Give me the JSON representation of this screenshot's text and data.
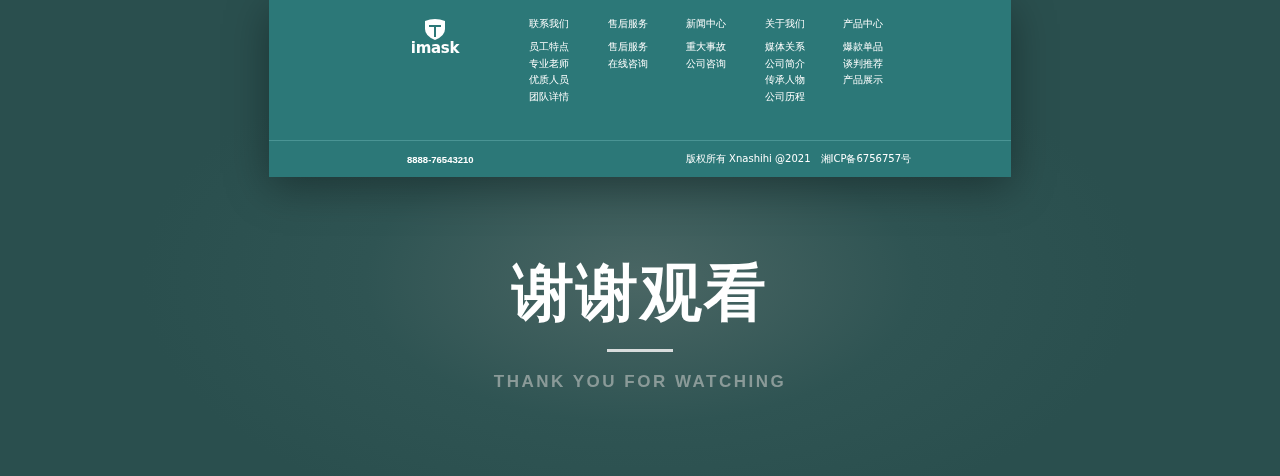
{
  "footer": {
    "logo": "imask",
    "columns": [
      {
        "title": "联系我们",
        "links": [
          "员工特点",
          "专业老师",
          "优质人员",
          "团队详情"
        ]
      },
      {
        "title": "售后服务",
        "links": [
          "售后服务",
          "在线咨询"
        ]
      },
      {
        "title": "新闻中心",
        "links": [
          "重大事故",
          "公司咨询"
        ]
      },
      {
        "title": "关于我们",
        "links": [
          "媒体关系",
          "公司简介",
          "传承人物",
          "公司历程"
        ]
      },
      {
        "title": "产品中心",
        "links": [
          "爆款单品",
          "谈判推荐",
          "产品展示"
        ]
      }
    ],
    "phone": "8888-76543210",
    "copyright": "版权所有 Xnashihi @2021",
    "icp": "湘ICP备6756757号"
  },
  "thanks": {
    "title": "谢谢观看",
    "subtitle": "THANK YOU FOR WATCHING"
  }
}
